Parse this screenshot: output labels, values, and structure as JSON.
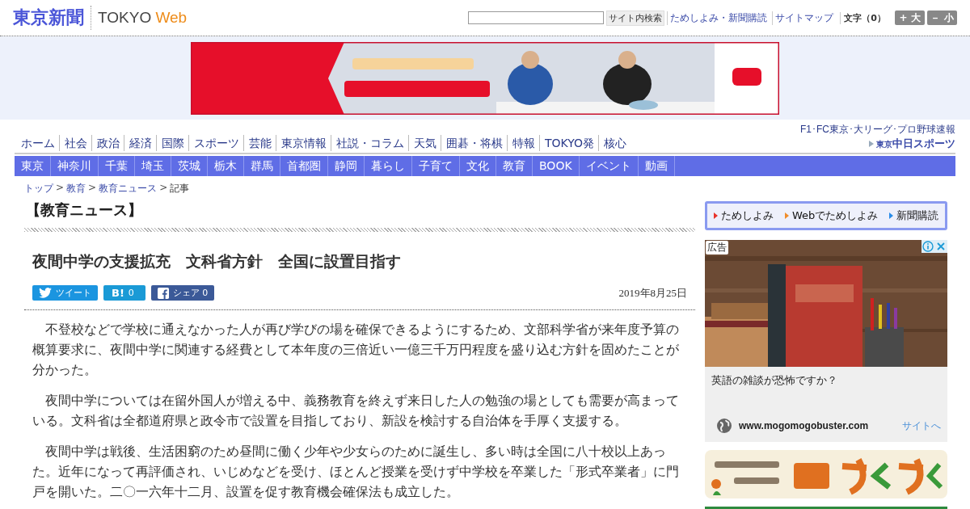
{
  "header": {
    "logo": {
      "title": "東京新聞",
      "subtitle_1": "TOKYO",
      "subtitle_2": "Web"
    },
    "search": {
      "button": "サイト内検索"
    },
    "links": [
      "ためしよみ・新聞購読",
      "サイトマップ"
    ],
    "font_size": {
      "label": "文字（0）",
      "buttons": [
        {
          "sign": "+",
          "label": "大"
        },
        {
          "sign": "－",
          "label": "小"
        }
      ]
    }
  },
  "nav_primary": [
    "ホーム",
    "社会",
    "政治",
    "経済",
    "国際",
    "スポーツ",
    "芸能",
    "東京情報",
    "社説・コラム",
    "天気",
    "囲碁・将棋",
    "特報",
    "TOKYO発",
    "核心"
  ],
  "nav_promo": {
    "caption": "F1･FC東京･大リーグ･プロ野球速報",
    "logo_1": "東京",
    "logo_2": "中日スポーツ"
  },
  "nav_secondary": [
    "東京",
    "神奈川",
    "千葉",
    "埼玉",
    "茨城",
    "栃木",
    "群馬",
    "首都圏",
    "静岡",
    "暮らし",
    "子育て",
    "文化",
    "教育",
    "BOOK",
    "イベント",
    "動画"
  ],
  "breadcrumb": [
    {
      "label": "トップ",
      "link": true
    },
    {
      "label": "教育",
      "link": true
    },
    {
      "label": "教育ニュース",
      "link": true
    },
    {
      "label": "記事",
      "link": false
    }
  ],
  "breadcrumb_separator": ">",
  "section_title": "【教育ニュース】",
  "article": {
    "title": "夜間中学の支援拡充　文科省方針　全国に設置目指す",
    "share": [
      {
        "kind": "twitter",
        "label": "ツイート"
      },
      {
        "kind": "hatena",
        "label": "B!",
        "count": "0"
      },
      {
        "kind": "facebook",
        "label": "シェア",
        "count": "0"
      }
    ],
    "date": "2019年8月25日",
    "paragraphs": [
      "不登校などで学校に通えなかった人が再び学びの場を確保できるようにするため、文部科学省が来年度予算の概算要求に、夜間中学に関連する経費として本年度の三倍近い一億三千万円程度を盛り込む方針を固めたことが分かった。",
      "夜間中学については在留外国人が増える中、義務教育を終えず来日した人の勉強の場としても需要が高まっている。文科省は全都道府県と政令市で設置を目指しており、新設を検討する自治体を手厚く支援する。",
      "夜間中学は戦後、生活困窮のため昼間に働く少年や少女らのために誕生し、多い時は全国に八十校以上あった。近年になって再評価され、いじめなどを受け、ほとんど授業を受けず中学校を卒業した「形式卒業者」に門戸を開いた。二〇一六年十二月、設置を促す教育機会確保法も成立した。"
    ]
  },
  "sidebar": {
    "subscribe": [
      {
        "label": "ためしよみ",
        "color": "#e8332a"
      },
      {
        "label": "Webでためしよみ",
        "color": "#f08c2a"
      },
      {
        "label": "新聞購読",
        "color": "#2a8ce8"
      }
    ],
    "ad": {
      "badge": "広告",
      "headline": "英語の雑談が恐怖ですか？",
      "url": "www.mogomogobuster.com",
      "cta": "サイトへ"
    }
  }
}
